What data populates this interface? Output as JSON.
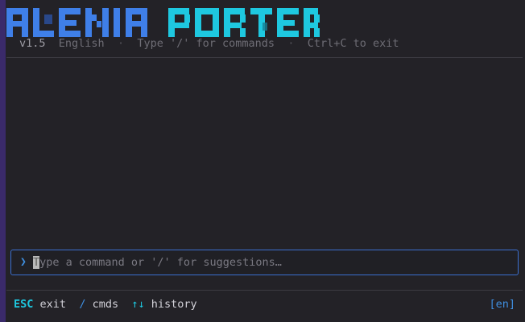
{
  "header": {
    "logo_text": "ALENIA PORTER",
    "version": "v1.5",
    "language": "English",
    "separator": "·",
    "hint_commands": "Type '/' for commands",
    "hint_exit": "Ctrl+C to exit"
  },
  "prompt": {
    "glyph": "❯",
    "placeholder": "Type a command or '/' for suggestions…"
  },
  "footer": {
    "esc_key": "ESC",
    "esc_label": "exit",
    "cmds_key": "/",
    "cmds_label": "cmds",
    "history_key": "↑↓",
    "history_label": "history",
    "lang_tag": "[en]"
  },
  "colors": {
    "background": "#232227",
    "logo_blue": "#3f7fe8",
    "logo_cyan": "#1ec8e0",
    "accent": "#3f8fe0",
    "muted_text": "#6e6d75"
  }
}
